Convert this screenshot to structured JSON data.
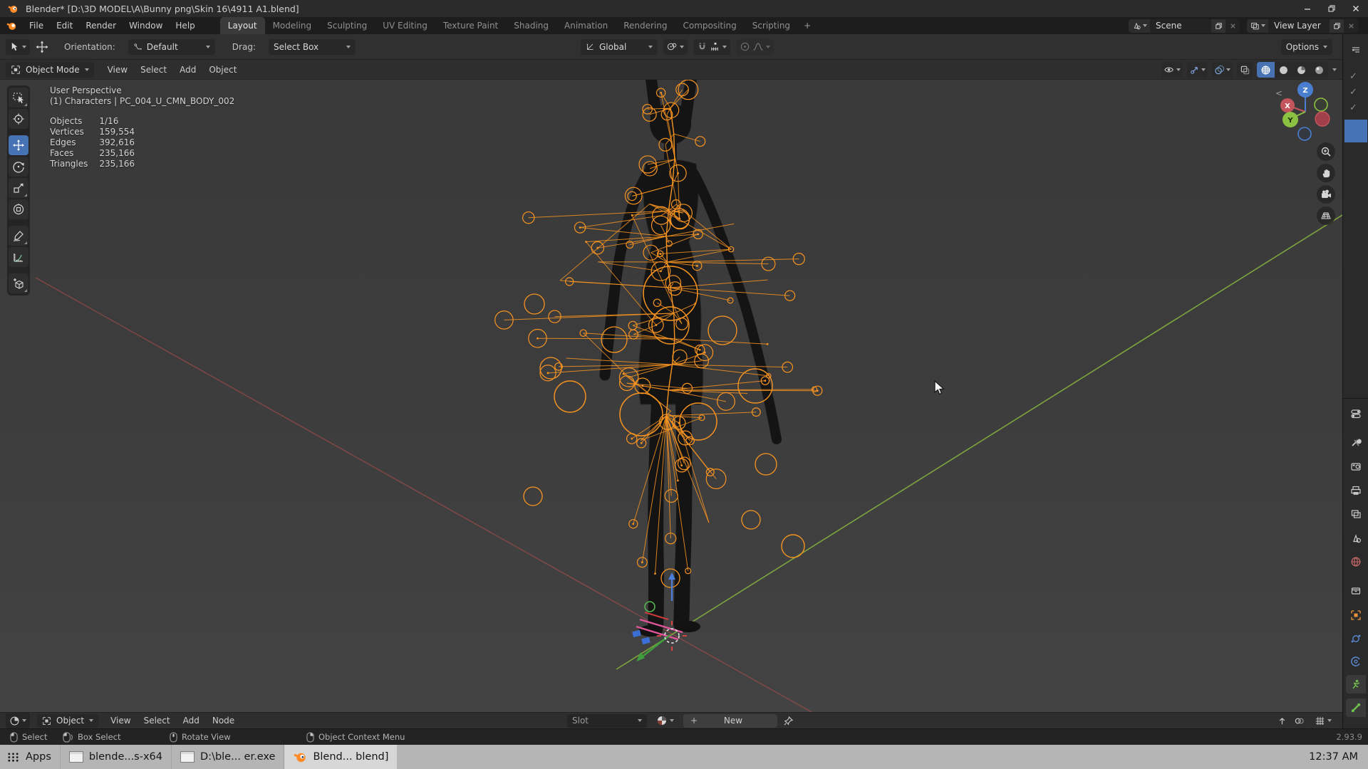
{
  "window": {
    "title": "Blender* [D:\\3D MODEL\\A\\Bunny png\\Skin 16\\4911 A1.blend]"
  },
  "menubar": {
    "menus": [
      "File",
      "Edit",
      "Render",
      "Window",
      "Help"
    ],
    "workspaces": [
      "Layout",
      "Modeling",
      "Sculpting",
      "UV Editing",
      "Texture Paint",
      "Shading",
      "Animation",
      "Rendering",
      "Compositing",
      "Scripting"
    ],
    "active_workspace": "Layout",
    "add_workspace": "+",
    "scene": "Scene",
    "view_layer": "View Layer"
  },
  "tool_settings": {
    "orientation_label": "Orientation:",
    "orientation_value": "Default",
    "drag_label": "Drag:",
    "drag_value": "Select Box",
    "transform_orientation": "Global",
    "options_button": "Options"
  },
  "viewport": {
    "header": {
      "mode": "Object Mode",
      "menus": [
        "View",
        "Select",
        "Add",
        "Object"
      ]
    },
    "stats": {
      "view": "User Perspective",
      "collection_path": "(1) Characters | PC_004_U_CMN_BODY_002",
      "rows": [
        {
          "label": "Objects",
          "value": "1/16"
        },
        {
          "label": "Vertices",
          "value": "159,554"
        },
        {
          "label": "Edges",
          "value": "392,616"
        },
        {
          "label": "Faces",
          "value": "235,166"
        },
        {
          "label": "Triangles",
          "value": "235,166"
        }
      ]
    },
    "gizmo_axes": {
      "x": "X",
      "y": "Y",
      "z": "Z"
    },
    "sidebar_toggle": "<"
  },
  "bottom_editor": {
    "mode": "Object",
    "menus": [
      "View",
      "Select",
      "Add",
      "Node"
    ],
    "slot_label": "Slot",
    "new_plus": "+",
    "new_button": "New"
  },
  "status_bar": {
    "hints": [
      {
        "icon": "mouse-left",
        "label": "Select"
      },
      {
        "icon": "mouse-left-drag",
        "label": "Box Select"
      },
      {
        "icon": "mouse-middle",
        "label": "Rotate View"
      },
      {
        "icon": "mouse-right",
        "label": "Object Context Menu"
      }
    ],
    "version": "2.93.9"
  },
  "taskbar": {
    "apps_label": "Apps",
    "windows": [
      {
        "label": "blende...s-x64",
        "active": false
      },
      {
        "label": "D:\\ble... er.exe",
        "active": false
      },
      {
        "label": "Blend... blend]",
        "active": true
      }
    ],
    "clock": "12:37 AM"
  },
  "colors": {
    "accent_blue": "#4772b3",
    "armature_orange": "#f79421",
    "axis_green": "#7ba83c",
    "axis_red": "#b14a4a"
  }
}
